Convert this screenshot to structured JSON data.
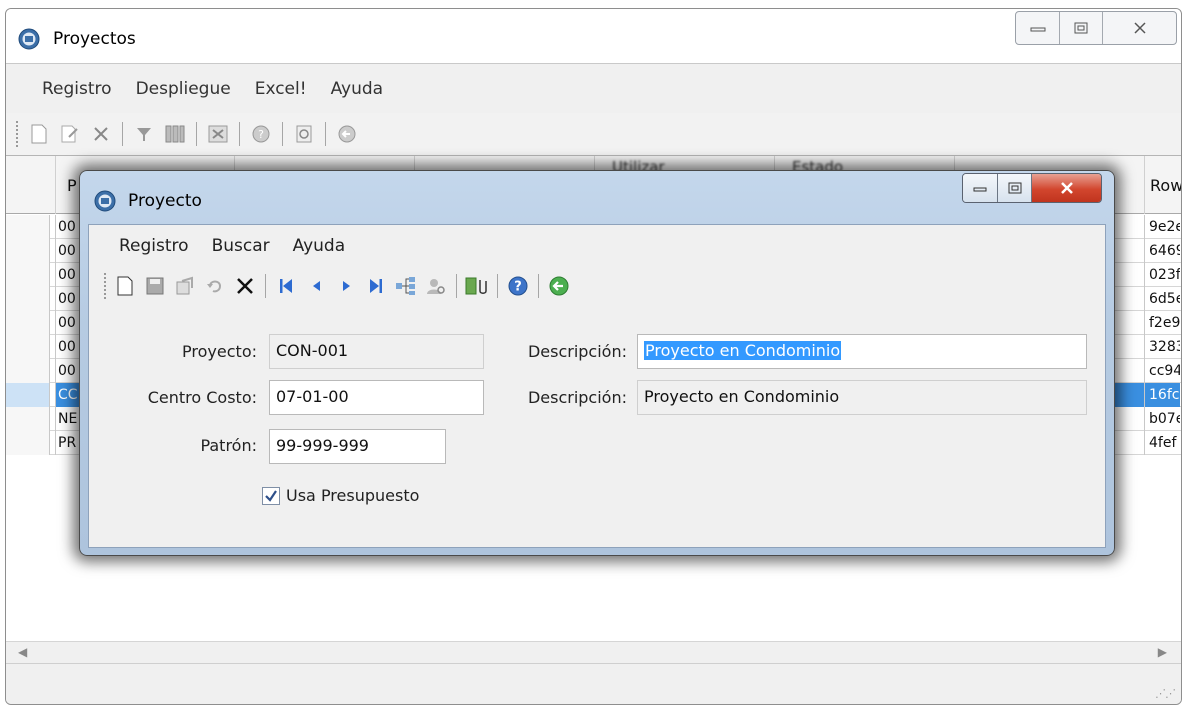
{
  "outer": {
    "title": "Proyectos",
    "menu": [
      "Registro",
      "Despliegue",
      "Excel!",
      "Ayuda"
    ],
    "grid": {
      "header_first": "P",
      "header_last": "Row",
      "header_utilizar": "Utilizar",
      "header_estado": "Estado",
      "left_codes": [
        "00",
        "00",
        "00",
        "00",
        "00",
        "00",
        "00",
        "CC",
        "NE",
        "PR"
      ],
      "right_codes": [
        "9e2e",
        "6469",
        "023f",
        "6d5e",
        "f2e9",
        "3283",
        "cc94",
        "16fc",
        "b07e",
        "4fef"
      ],
      "selected_row": 7
    }
  },
  "dialog": {
    "title": "Proyecto",
    "menu": [
      "Registro",
      "Buscar",
      "Ayuda"
    ],
    "fields": {
      "proyecto_label": "Proyecto:",
      "proyecto_value": "CON-001",
      "descripcion1_label": "Descripción:",
      "descripcion1_value": "Proyecto en Condominio",
      "centro_label": "Centro Costo:",
      "centro_value": "07-01-00",
      "descripcion2_label": "Descripción:",
      "descripcion2_value": "Proyecto en Condominio",
      "patron_label": "Patrón:",
      "patron_value": "99-999-999",
      "usa_presupuesto_label": "Usa Presupuesto",
      "usa_presupuesto_checked": true
    }
  },
  "colors": {
    "selection": "#3a8fe0",
    "text_highlight": "#3399ff",
    "close_button": "#d2462e"
  },
  "icons": {
    "outer_toolbar": [
      "new-icon",
      "edit-icon",
      "delete-icon",
      "filter-icon",
      "columns-icon",
      "excel-icon",
      "help-icon",
      "refresh-icon",
      "exit-icon"
    ],
    "dialog_toolbar": [
      "new-icon",
      "save-icon",
      "copy-icon",
      "undo-icon",
      "delete-icon",
      "first-icon",
      "prev-icon",
      "next-icon",
      "last-icon",
      "tree-icon",
      "search-user-icon",
      "attach-icon",
      "help-icon",
      "exit-icon"
    ]
  }
}
